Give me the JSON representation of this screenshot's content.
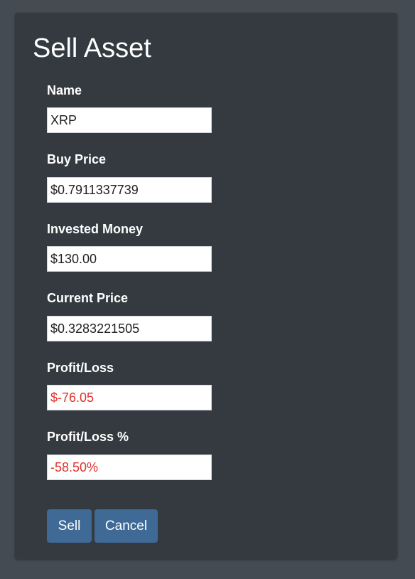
{
  "form": {
    "title": "Sell Asset",
    "fields": [
      {
        "label": "Name",
        "value": "XRP"
      },
      {
        "label": "Buy Price",
        "value": "$0.7911337739"
      },
      {
        "label": "Invested Money",
        "value": "$130.00"
      },
      {
        "label": "Current Price",
        "value": "$0.3283221505"
      },
      {
        "label": "Profit/Loss",
        "value": "$-76.05"
      },
      {
        "label": "Profit/Loss %",
        "value": "-58.50%"
      }
    ],
    "sell_label": "Sell",
    "cancel_label": "Cancel"
  },
  "colors": {
    "page_background": "#444b52",
    "panel_background": "#343a40",
    "button": "#3f6a96",
    "negative_value": "#e0312b"
  }
}
